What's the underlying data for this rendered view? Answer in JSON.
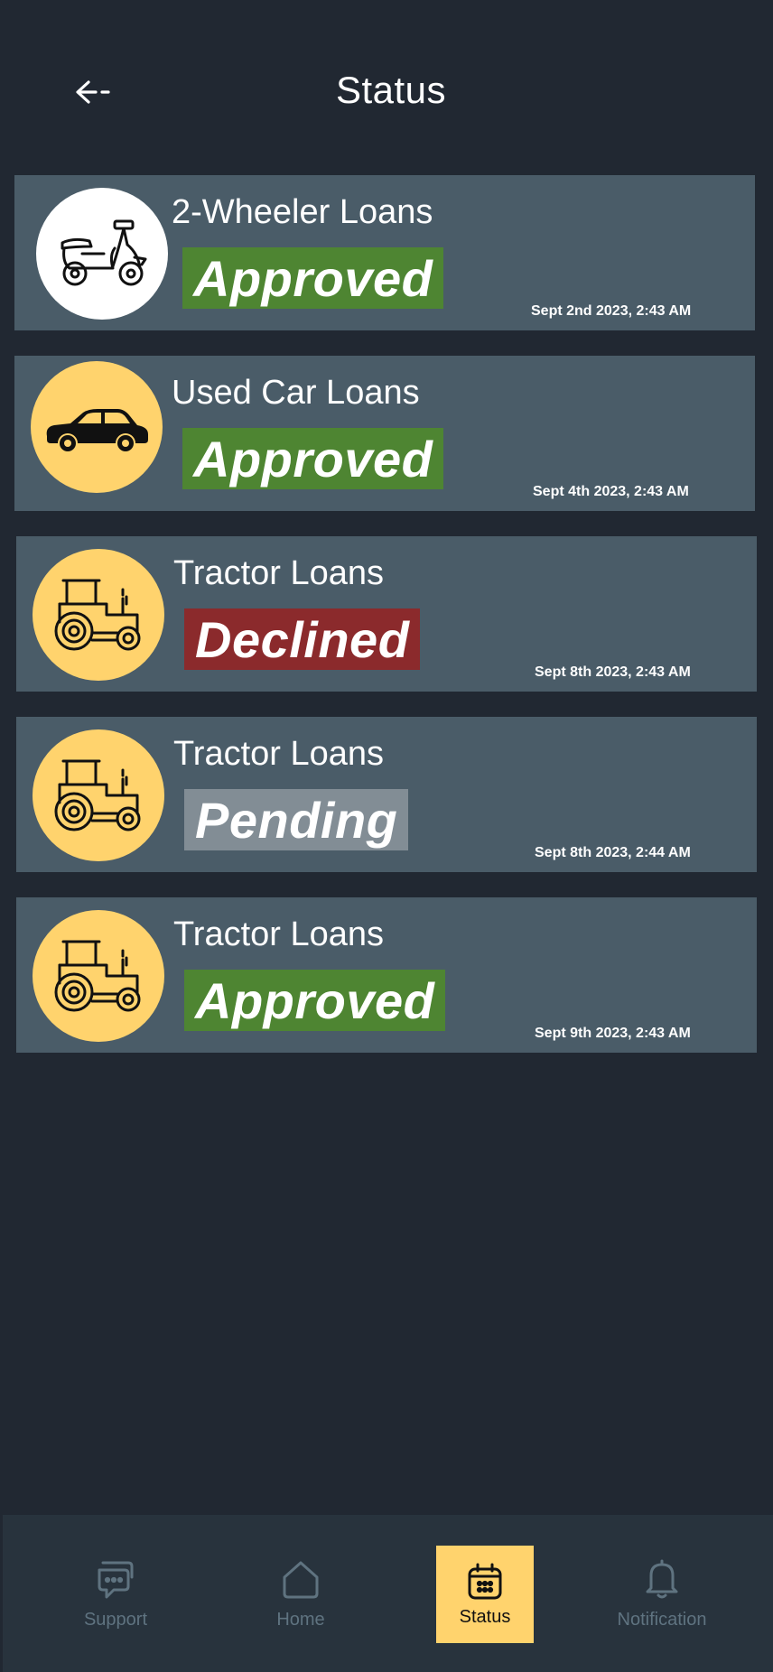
{
  "header": {
    "back_icon": "back-arrow-icon",
    "title": "Status"
  },
  "cards": [
    {
      "title": "2-Wheeler Loans",
      "status": "Approved",
      "status_color": "#4e8532",
      "timestamp": "Sept 2nd 2023, 2:43 AM",
      "icon": "scooter-icon",
      "icon_bg": "#ffffff"
    },
    {
      "title": "Used Car Loans",
      "status": "Approved",
      "status_color": "#4e8532",
      "timestamp": "Sept 4th 2023, 2:43 AM",
      "icon": "car-icon",
      "icon_bg": "#ffd36d"
    },
    {
      "title": "Tractor Loans",
      "status": "Declined",
      "status_color": "#8b2a2c",
      "timestamp": "Sept 8th 2023, 2:43 AM",
      "icon": "tractor-icon",
      "icon_bg": "#ffd36d"
    },
    {
      "title": "Tractor Loans",
      "status": "Pending",
      "status_color": "#828d95",
      "timestamp": "Sept 8th 2023, 2:44 AM",
      "icon": "tractor-icon",
      "icon_bg": "#ffd36d"
    },
    {
      "title": "Tractor Loans",
      "status": "Approved",
      "status_color": "#4e8532",
      "timestamp": "Sept 9th 2023, 2:43 AM",
      "icon": "tractor-icon",
      "icon_bg": "#ffd36d"
    }
  ],
  "bottom_nav": {
    "items": [
      {
        "label": "Support",
        "icon": "support-chat-icon",
        "active": false
      },
      {
        "label": "Home",
        "icon": "home-icon",
        "active": false
      },
      {
        "label": "Status",
        "icon": "calendar-icon",
        "active": true
      },
      {
        "label": "Notification",
        "icon": "bell-icon",
        "active": false
      }
    ]
  },
  "colors": {
    "background": "#212832",
    "card": "#4a5c68",
    "nav_background": "#28333d",
    "accent": "#ffd36d",
    "inactive_nav": "#5f7380"
  }
}
